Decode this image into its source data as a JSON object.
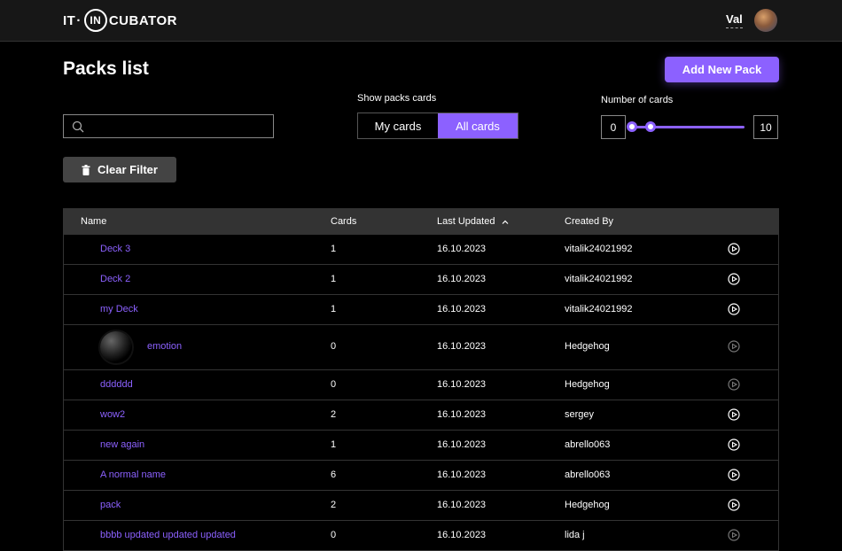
{
  "header": {
    "logo": {
      "part1": "IT",
      "dot": "·",
      "circle": "IN",
      "part2": "CUBATOR"
    },
    "user_name": "Val"
  },
  "page": {
    "title": "Packs list",
    "add_button": "Add New Pack",
    "search_placeholder": "",
    "show_packs_label": "Show packs cards",
    "toggle": {
      "my": "My cards",
      "all": "All cards",
      "selected": "all"
    },
    "number_label": "Number of cards",
    "range_min": "0",
    "range_max": "10",
    "clear_filter": "Clear Filter"
  },
  "table": {
    "headers": {
      "name": "Name",
      "cards": "Cards",
      "updated": "Last Updated",
      "created": "Created By"
    },
    "rows": [
      {
        "name": "Deck 3",
        "cards": "1",
        "updated": "16.10.2023",
        "created": "vitalik24021992",
        "active": true
      },
      {
        "name": "Deck 2",
        "cards": "1",
        "updated": "16.10.2023",
        "created": "vitalik24021992",
        "active": true
      },
      {
        "name": "my Deck",
        "cards": "1",
        "updated": "16.10.2023",
        "created": "vitalik24021992",
        "active": true
      },
      {
        "name": "emotion",
        "cards": "0",
        "updated": "16.10.2023",
        "created": "Hedgehog",
        "active": false,
        "image": true
      },
      {
        "name": "dddddd",
        "cards": "0",
        "updated": "16.10.2023",
        "created": "Hedgehog",
        "active": false
      },
      {
        "name": "wow2",
        "cards": "2",
        "updated": "16.10.2023",
        "created": "sergey",
        "active": true
      },
      {
        "name": "new again",
        "cards": "1",
        "updated": "16.10.2023",
        "created": "abrello063",
        "active": true
      },
      {
        "name": "A normal name",
        "cards": "6",
        "updated": "16.10.2023",
        "created": "abrello063",
        "active": true
      },
      {
        "name": "pack",
        "cards": "2",
        "updated": "16.10.2023",
        "created": "Hedgehog",
        "active": true
      },
      {
        "name": "bbbb updated updated updated",
        "cards": "0",
        "updated": "16.10.2023",
        "created": "lida j",
        "active": false
      }
    ]
  },
  "colors": {
    "accent": "#8c61ff",
    "play_active": "#ffffff",
    "play_inactive": "#777777"
  }
}
